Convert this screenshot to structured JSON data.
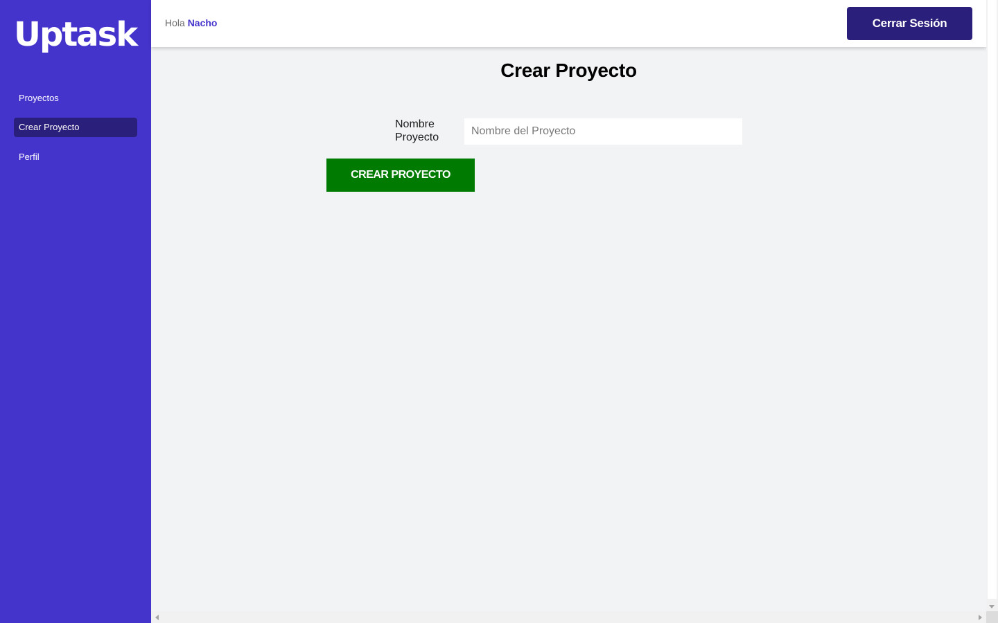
{
  "app": {
    "logo_text": "Uptask"
  },
  "colors": {
    "sidebar_bg": "#4534cc",
    "active_nav_bg": "#2a1f7a",
    "logout_bg": "#2a1f7a",
    "create_bg": "#007a00",
    "user_name_color": "#4534cc"
  },
  "sidebar": {
    "items": [
      {
        "label": "Proyectos",
        "active": false
      },
      {
        "label": "Crear Proyecto",
        "active": true
      },
      {
        "label": "Perfil",
        "active": false
      }
    ]
  },
  "header": {
    "greeting": "Hola",
    "user_name": "Nacho",
    "logout_label": "Cerrar Sesión"
  },
  "main": {
    "title": "Crear Proyecto",
    "form": {
      "name_label": "Nombre Proyecto",
      "name_placeholder": "Nombre del Proyecto",
      "name_value": "",
      "submit_label": "CREAR PROYECTO"
    }
  }
}
